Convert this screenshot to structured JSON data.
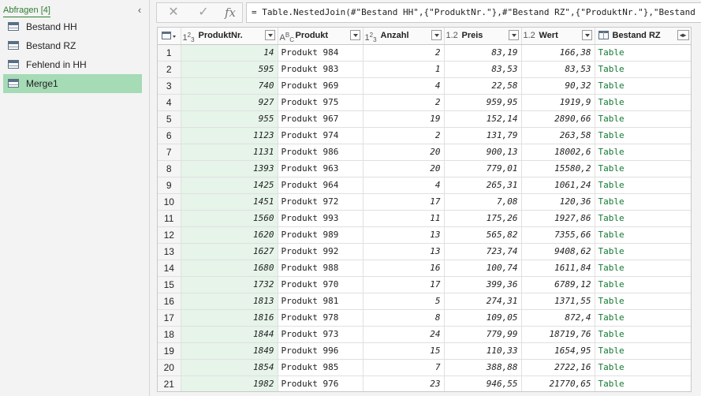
{
  "queries": {
    "title": "Abfragen [4]",
    "collapse_icon": "chevron-left-icon",
    "items": [
      {
        "label": "Bestand HH",
        "active": false
      },
      {
        "label": "Bestand RZ",
        "active": false
      },
      {
        "label": "Fehlend in HH",
        "active": false
      },
      {
        "label": "Merge1",
        "active": true
      }
    ]
  },
  "formula_bar": {
    "cancel_glyph": "✕",
    "confirm_glyph": "✓",
    "fx_glyph": "fx",
    "formula": "= Table.NestedJoin(#\"Bestand HH\",{\"ProduktNr.\"},#\"Bestand RZ\",{\"ProduktNr.\"},\"Bestand RZ\",JoinKind.LeftOuter)"
  },
  "grid": {
    "columns": [
      {
        "name": "ProduktNr.",
        "type_icon": "whole-number-icon"
      },
      {
        "name": "Produkt",
        "type_icon": "text-icon"
      },
      {
        "name": "Anzahl",
        "type_icon": "whole-number-icon"
      },
      {
        "name": "Preis",
        "type_icon": "decimal-icon"
      },
      {
        "name": "Wert",
        "type_icon": "decimal-icon"
      },
      {
        "name": "Bestand RZ",
        "type_icon": "table-icon"
      }
    ],
    "type_labels": {
      "whole": "123",
      "text": "ABC",
      "decimal": "1.2"
    },
    "rows": [
      [
        "1",
        "14",
        "Produkt 984",
        "2",
        "83,19",
        "166,38",
        "Table"
      ],
      [
        "2",
        "595",
        "Produkt 983",
        "1",
        "83,53",
        "83,53",
        "Table"
      ],
      [
        "3",
        "740",
        "Produkt 969",
        "4",
        "22,58",
        "90,32",
        "Table"
      ],
      [
        "4",
        "927",
        "Produkt 975",
        "2",
        "959,95",
        "1919,9",
        "Table"
      ],
      [
        "5",
        "955",
        "Produkt 967",
        "19",
        "152,14",
        "2890,66",
        "Table"
      ],
      [
        "6",
        "1123",
        "Produkt 974",
        "2",
        "131,79",
        "263,58",
        "Table"
      ],
      [
        "7",
        "1131",
        "Produkt 986",
        "20",
        "900,13",
        "18002,6",
        "Table"
      ],
      [
        "8",
        "1393",
        "Produkt 963",
        "20",
        "779,01",
        "15580,2",
        "Table"
      ],
      [
        "9",
        "1425",
        "Produkt 964",
        "4",
        "265,31",
        "1061,24",
        "Table"
      ],
      [
        "10",
        "1451",
        "Produkt 972",
        "17",
        "7,08",
        "120,36",
        "Table"
      ],
      [
        "11",
        "1560",
        "Produkt 993",
        "11",
        "175,26",
        "1927,86",
        "Table"
      ],
      [
        "12",
        "1620",
        "Produkt 989",
        "13",
        "565,82",
        "7355,66",
        "Table"
      ],
      [
        "13",
        "1627",
        "Produkt 992",
        "13",
        "723,74",
        "9408,62",
        "Table"
      ],
      [
        "14",
        "1680",
        "Produkt 988",
        "16",
        "100,74",
        "1611,84",
        "Table"
      ],
      [
        "15",
        "1732",
        "Produkt 970",
        "17",
        "399,36",
        "6789,12",
        "Table"
      ],
      [
        "16",
        "1813",
        "Produkt 981",
        "5",
        "274,31",
        "1371,55",
        "Table"
      ],
      [
        "17",
        "1816",
        "Produkt 978",
        "8",
        "109,05",
        "872,4",
        "Table"
      ],
      [
        "18",
        "1844",
        "Produkt 973",
        "24",
        "779,99",
        "18719,76",
        "Table"
      ],
      [
        "19",
        "1849",
        "Produkt 996",
        "15",
        "110,33",
        "1654,95",
        "Table"
      ],
      [
        "20",
        "1854",
        "Produkt 985",
        "7",
        "388,88",
        "2722,16",
        "Table"
      ],
      [
        "21",
        "1982",
        "Produkt 976",
        "23",
        "946,55",
        "21770,65",
        "Table"
      ]
    ]
  },
  "colors": {
    "accent_green": "#2e7d32",
    "selected_query": "#a5dbb5",
    "selected_column": "#e6f4ea",
    "link_green": "#127a31"
  }
}
